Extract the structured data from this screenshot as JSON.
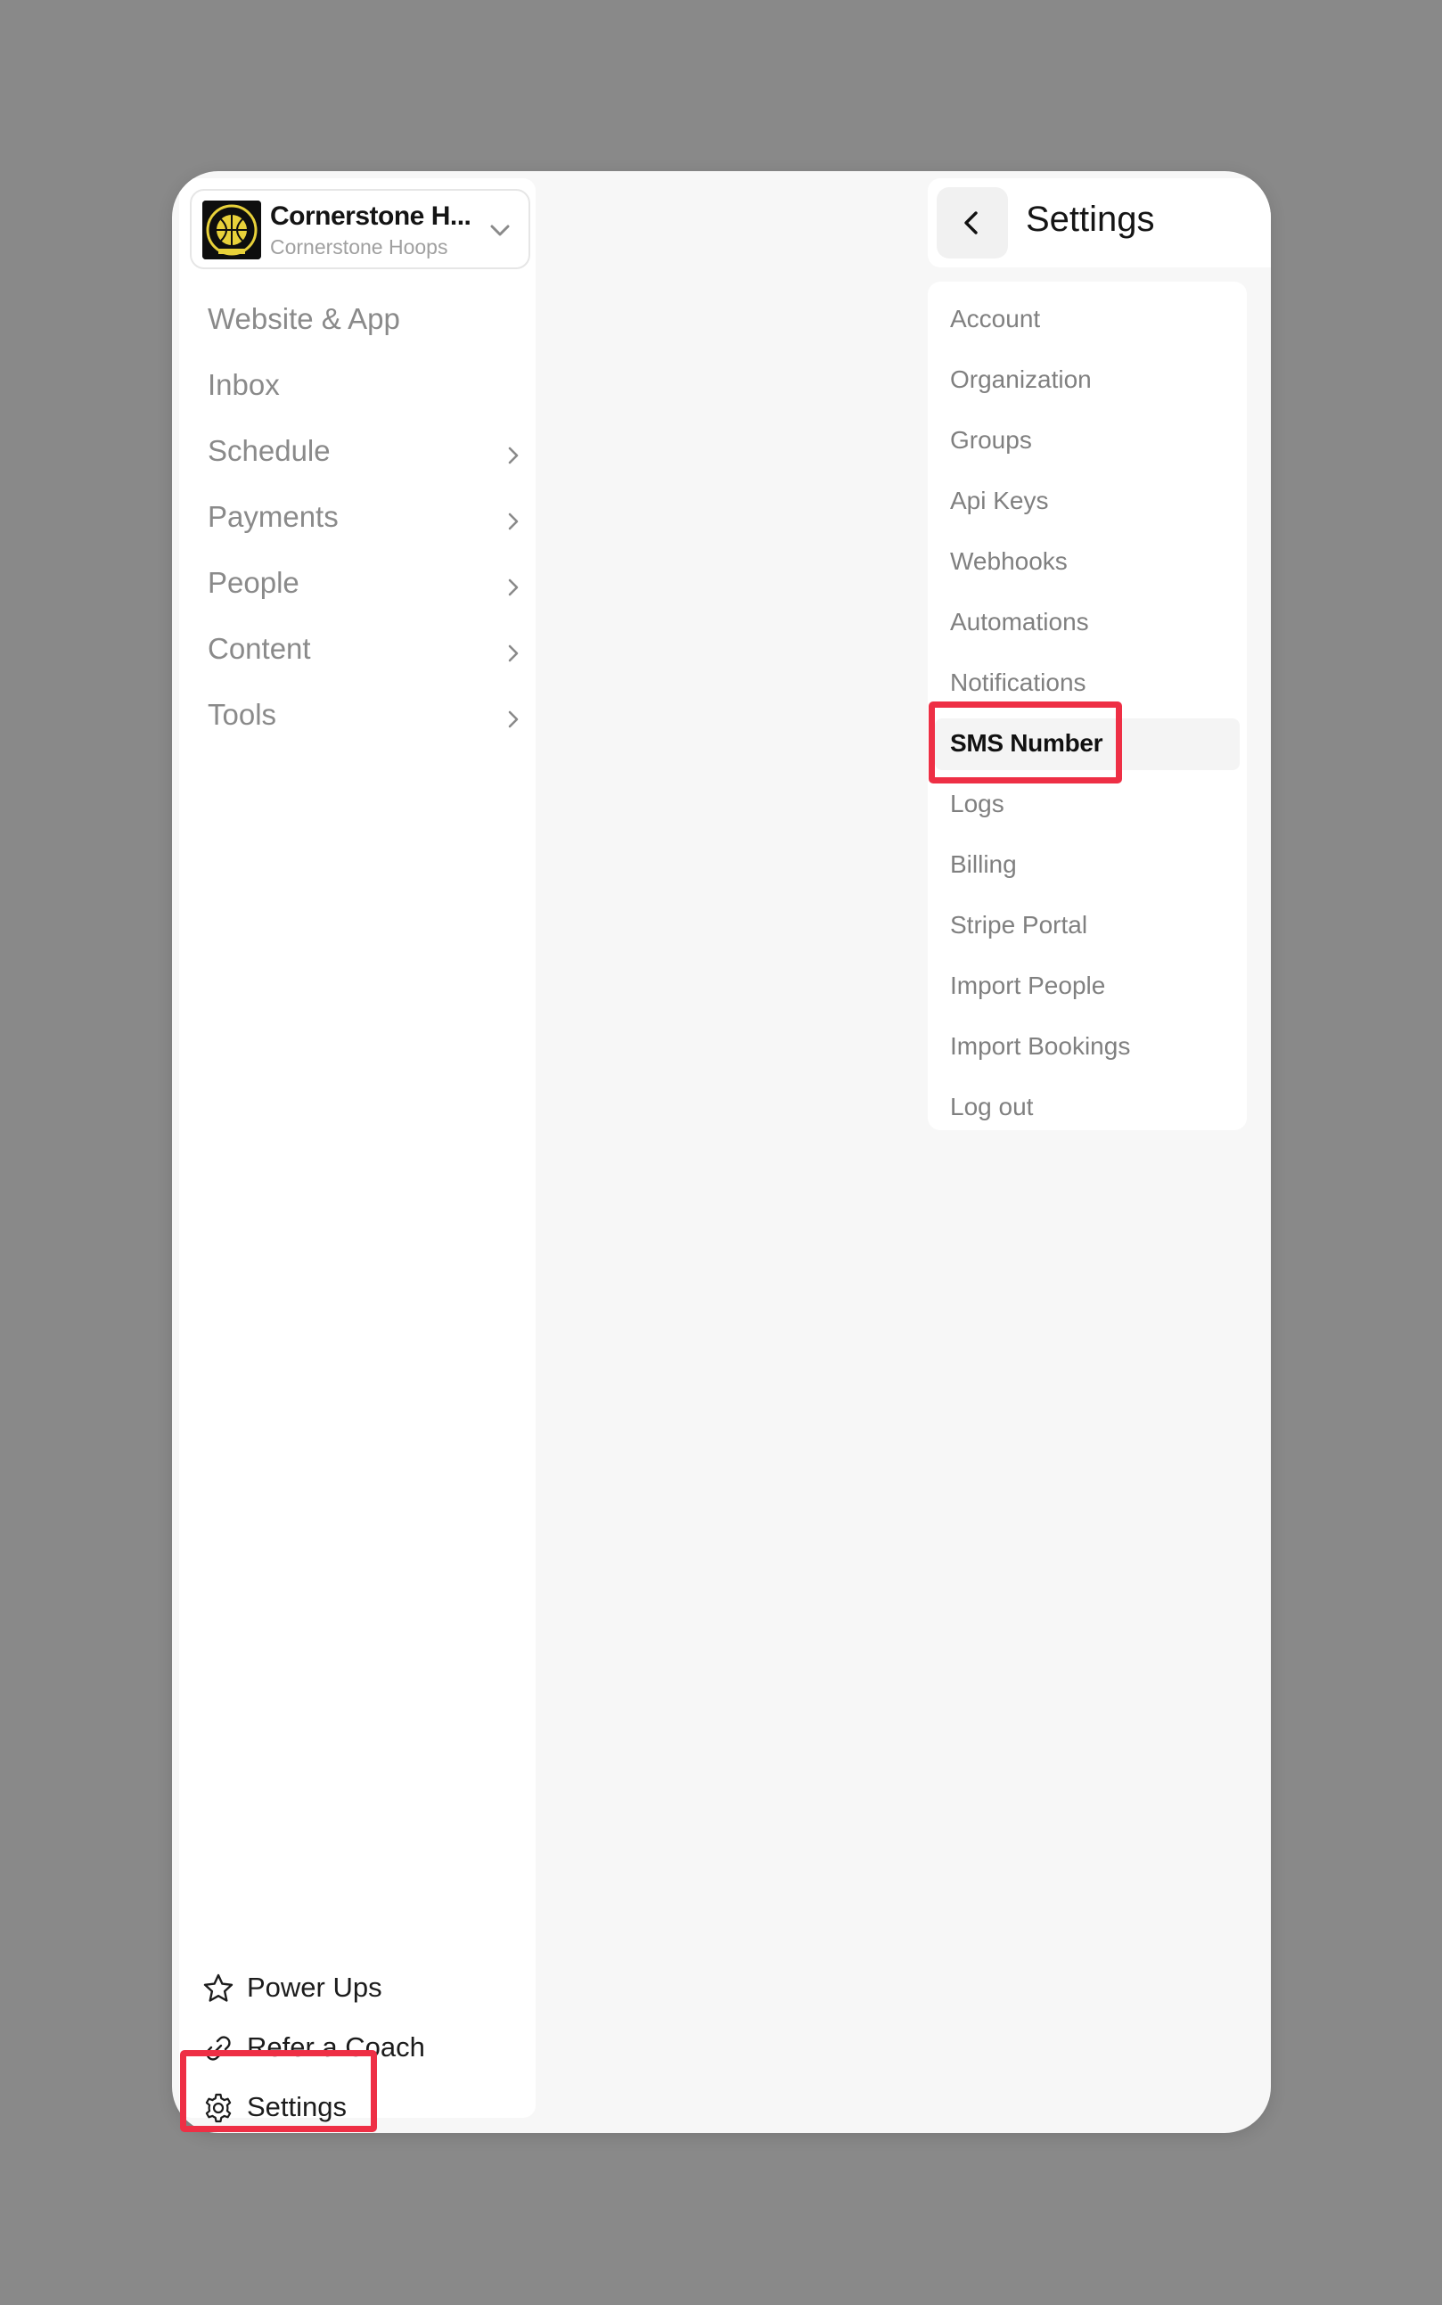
{
  "org": {
    "name": "Cornerstone H...",
    "subtitle": "Cornerstone Hoops",
    "logo_icon": "basketball-logo"
  },
  "nav": {
    "items": [
      {
        "label": "Website & App",
        "has_chevron": false
      },
      {
        "label": "Inbox",
        "has_chevron": false
      },
      {
        "label": "Schedule",
        "has_chevron": true
      },
      {
        "label": "Payments",
        "has_chevron": true
      },
      {
        "label": "People",
        "has_chevron": true
      },
      {
        "label": "Content",
        "has_chevron": true
      },
      {
        "label": "Tools",
        "has_chevron": true
      }
    ]
  },
  "bottom_nav": {
    "power_ups": {
      "label": "Power Ups",
      "icon": "star-icon"
    },
    "refer": {
      "label": "Refer a Coach",
      "icon": "link-icon"
    },
    "settings": {
      "label": "Settings",
      "icon": "gear-icon"
    }
  },
  "settings_panel": {
    "title": "Settings",
    "back_icon": "chevron-left-icon",
    "items": [
      {
        "label": "Account"
      },
      {
        "label": "Organization"
      },
      {
        "label": "Groups"
      },
      {
        "label": "Api Keys"
      },
      {
        "label": "Webhooks"
      },
      {
        "label": "Automations"
      },
      {
        "label": "Notifications"
      },
      {
        "label": "SMS Number",
        "active": true
      },
      {
        "label": "Logs"
      },
      {
        "label": "Billing"
      },
      {
        "label": "Stripe Portal"
      },
      {
        "label": "Import People"
      },
      {
        "label": "Import Bookings"
      },
      {
        "label": "Log out"
      }
    ]
  },
  "colors": {
    "backdrop": "#898989",
    "highlight": "#ee2f45",
    "muted_text": "#8a8a8a"
  }
}
